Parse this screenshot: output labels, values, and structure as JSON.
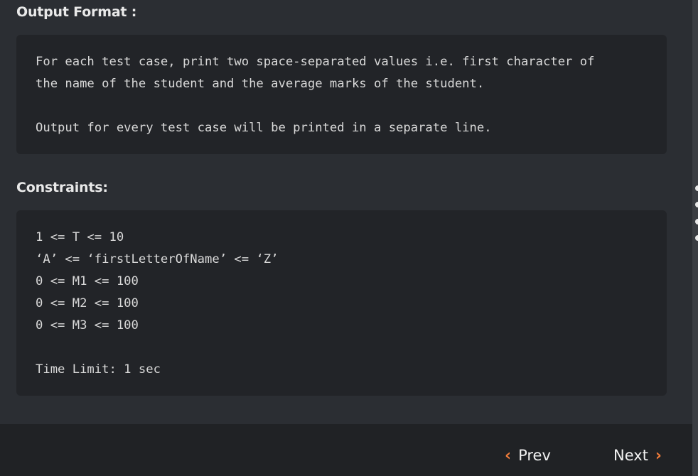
{
  "output_format": {
    "heading": "Output Format :",
    "lines": [
      "For each test case, print two space-separated values i.e. first character of",
      "the name of the student and the average marks of the student.",
      "",
      "Output for every test case will be printed in a separate line."
    ]
  },
  "constraints": {
    "heading": "Constraints:",
    "lines": [
      "1 <= T <= 10",
      "‘A’ <= ‘firstLetterOfName’ <= ‘Z’",
      "0 <= M1 <= 100",
      "0 <= M2 <= 100",
      "0 <= M3 <= 100",
      "",
      "Time Limit: 1 sec"
    ]
  },
  "footer": {
    "prev_label": "Prev",
    "next_label": "Next",
    "prev_icon": "chevron-left-icon",
    "next_icon": "chevron-right-icon"
  },
  "colors": {
    "background": "#2b2e33",
    "code_background": "#222428",
    "footer_background": "#202225",
    "accent": "#f07c3a"
  }
}
